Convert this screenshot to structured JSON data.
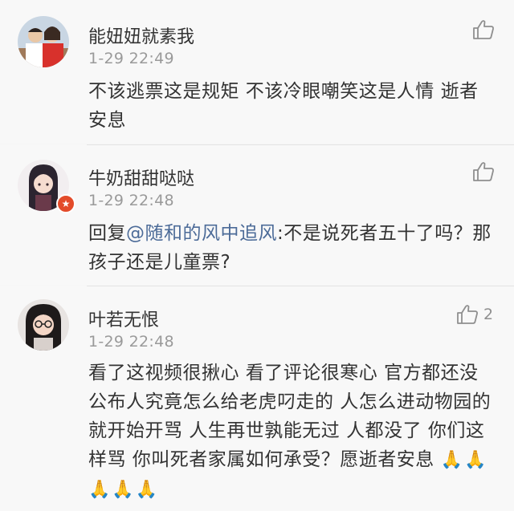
{
  "comments": [
    {
      "username": "能妞妞就素我",
      "time": "1-29 22:49",
      "content": "不该逃票这是规矩 不该冷眼嘲笑这是人情 逝者安息",
      "like_count": ""
    },
    {
      "username": "牛奶甜甜哒哒",
      "time": "1-29 22:48",
      "reply_prefix": "回复",
      "mention": "@随和的风中追风",
      "content": ":不是说死者五十了吗？那孩子还是儿童票?",
      "like_count": ""
    },
    {
      "username": "叶若无恨",
      "time": "1-29 22:48",
      "content": "看了这视频很揪心 看了评论很寒心 官方都还没公布人究竟怎么给老虎叼走的 人怎么进动物园的 就开始开骂 人生再世孰能无过 人都没了 你们这样骂 你叫死者家属如何承受？愿逝者安息",
      "emoji": "🙏🙏🙏🙏🙏",
      "like_count": "2"
    }
  ],
  "icons": {
    "like": "thumbs-up-icon",
    "badge": "vip-badge-icon"
  },
  "colors": {
    "background": "#f8f8f8",
    "mention": "#4c6b98",
    "time": "#9a9a9a",
    "badge": "#e34b2a"
  }
}
